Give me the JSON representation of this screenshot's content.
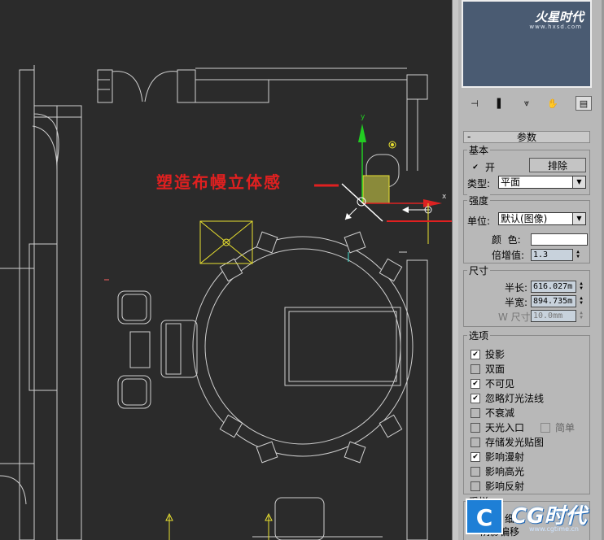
{
  "viewport": {
    "callout_text": "塑造布幔立体感",
    "axis_y": "y",
    "axis_x": "x"
  },
  "preview": {
    "logo": "火星时代",
    "logo_sub": "www.hxsd.com"
  },
  "toolbar": {
    "pin": "⊣",
    "modifier": "▌",
    "hierarchy": "⩔",
    "motion": "✋",
    "utilities": "▤"
  },
  "rollout": {
    "minus": "-",
    "title": "参数"
  },
  "basic": {
    "title": "基本",
    "on_label": "开",
    "on_checked": "✔",
    "exclude_label": "排除",
    "type_label": "类型:",
    "type_value": "平面"
  },
  "intensity": {
    "title": "强度",
    "unit_label": "单位:",
    "unit_value": "默认(图像)",
    "color_label": "颜  色:",
    "color_value": "#ffffff",
    "multiplier_label": "倍增值:",
    "multiplier_value": "1.3"
  },
  "size": {
    "title": "尺寸",
    "half_length_label": "半长:",
    "half_length_value": "616.027m",
    "half_width_label": "半宽:",
    "half_width_value": "894.735m",
    "w_size_label": "W 尺寸",
    "w_size_value": "10.0mm"
  },
  "options": {
    "title": "选项",
    "items": [
      {
        "label": "投影",
        "checked": "✔"
      },
      {
        "label": "双面",
        "checked": ""
      },
      {
        "label": "不可见",
        "checked": "✔"
      },
      {
        "label": "忽略灯光法线",
        "checked": "✔"
      },
      {
        "label": "不衰减",
        "checked": ""
      },
      {
        "label": "天光入口",
        "checked": ""
      },
      {
        "label": "存储发光贴图",
        "checked": ""
      },
      {
        "label": "影响漫射",
        "checked": "✔"
      },
      {
        "label": "影响高光",
        "checked": ""
      },
      {
        "label": "影响反射",
        "checked": ""
      }
    ],
    "simple_label": "简单"
  },
  "sampling": {
    "title": "采样",
    "subdiv_label": "细",
    "shadow_label": "阴影偏移"
  },
  "watermark": {
    "cg_box": "C",
    "cg_text": "CG时代",
    "url": "www.cgtime.cn"
  },
  "colors": {
    "viewport_bg": "#2b2b2b",
    "wire": "#cfcfcf",
    "selected": "#e8e030",
    "callout": "#e02020",
    "axis_y": "#22cc22",
    "axis_x": "#dd2222"
  }
}
